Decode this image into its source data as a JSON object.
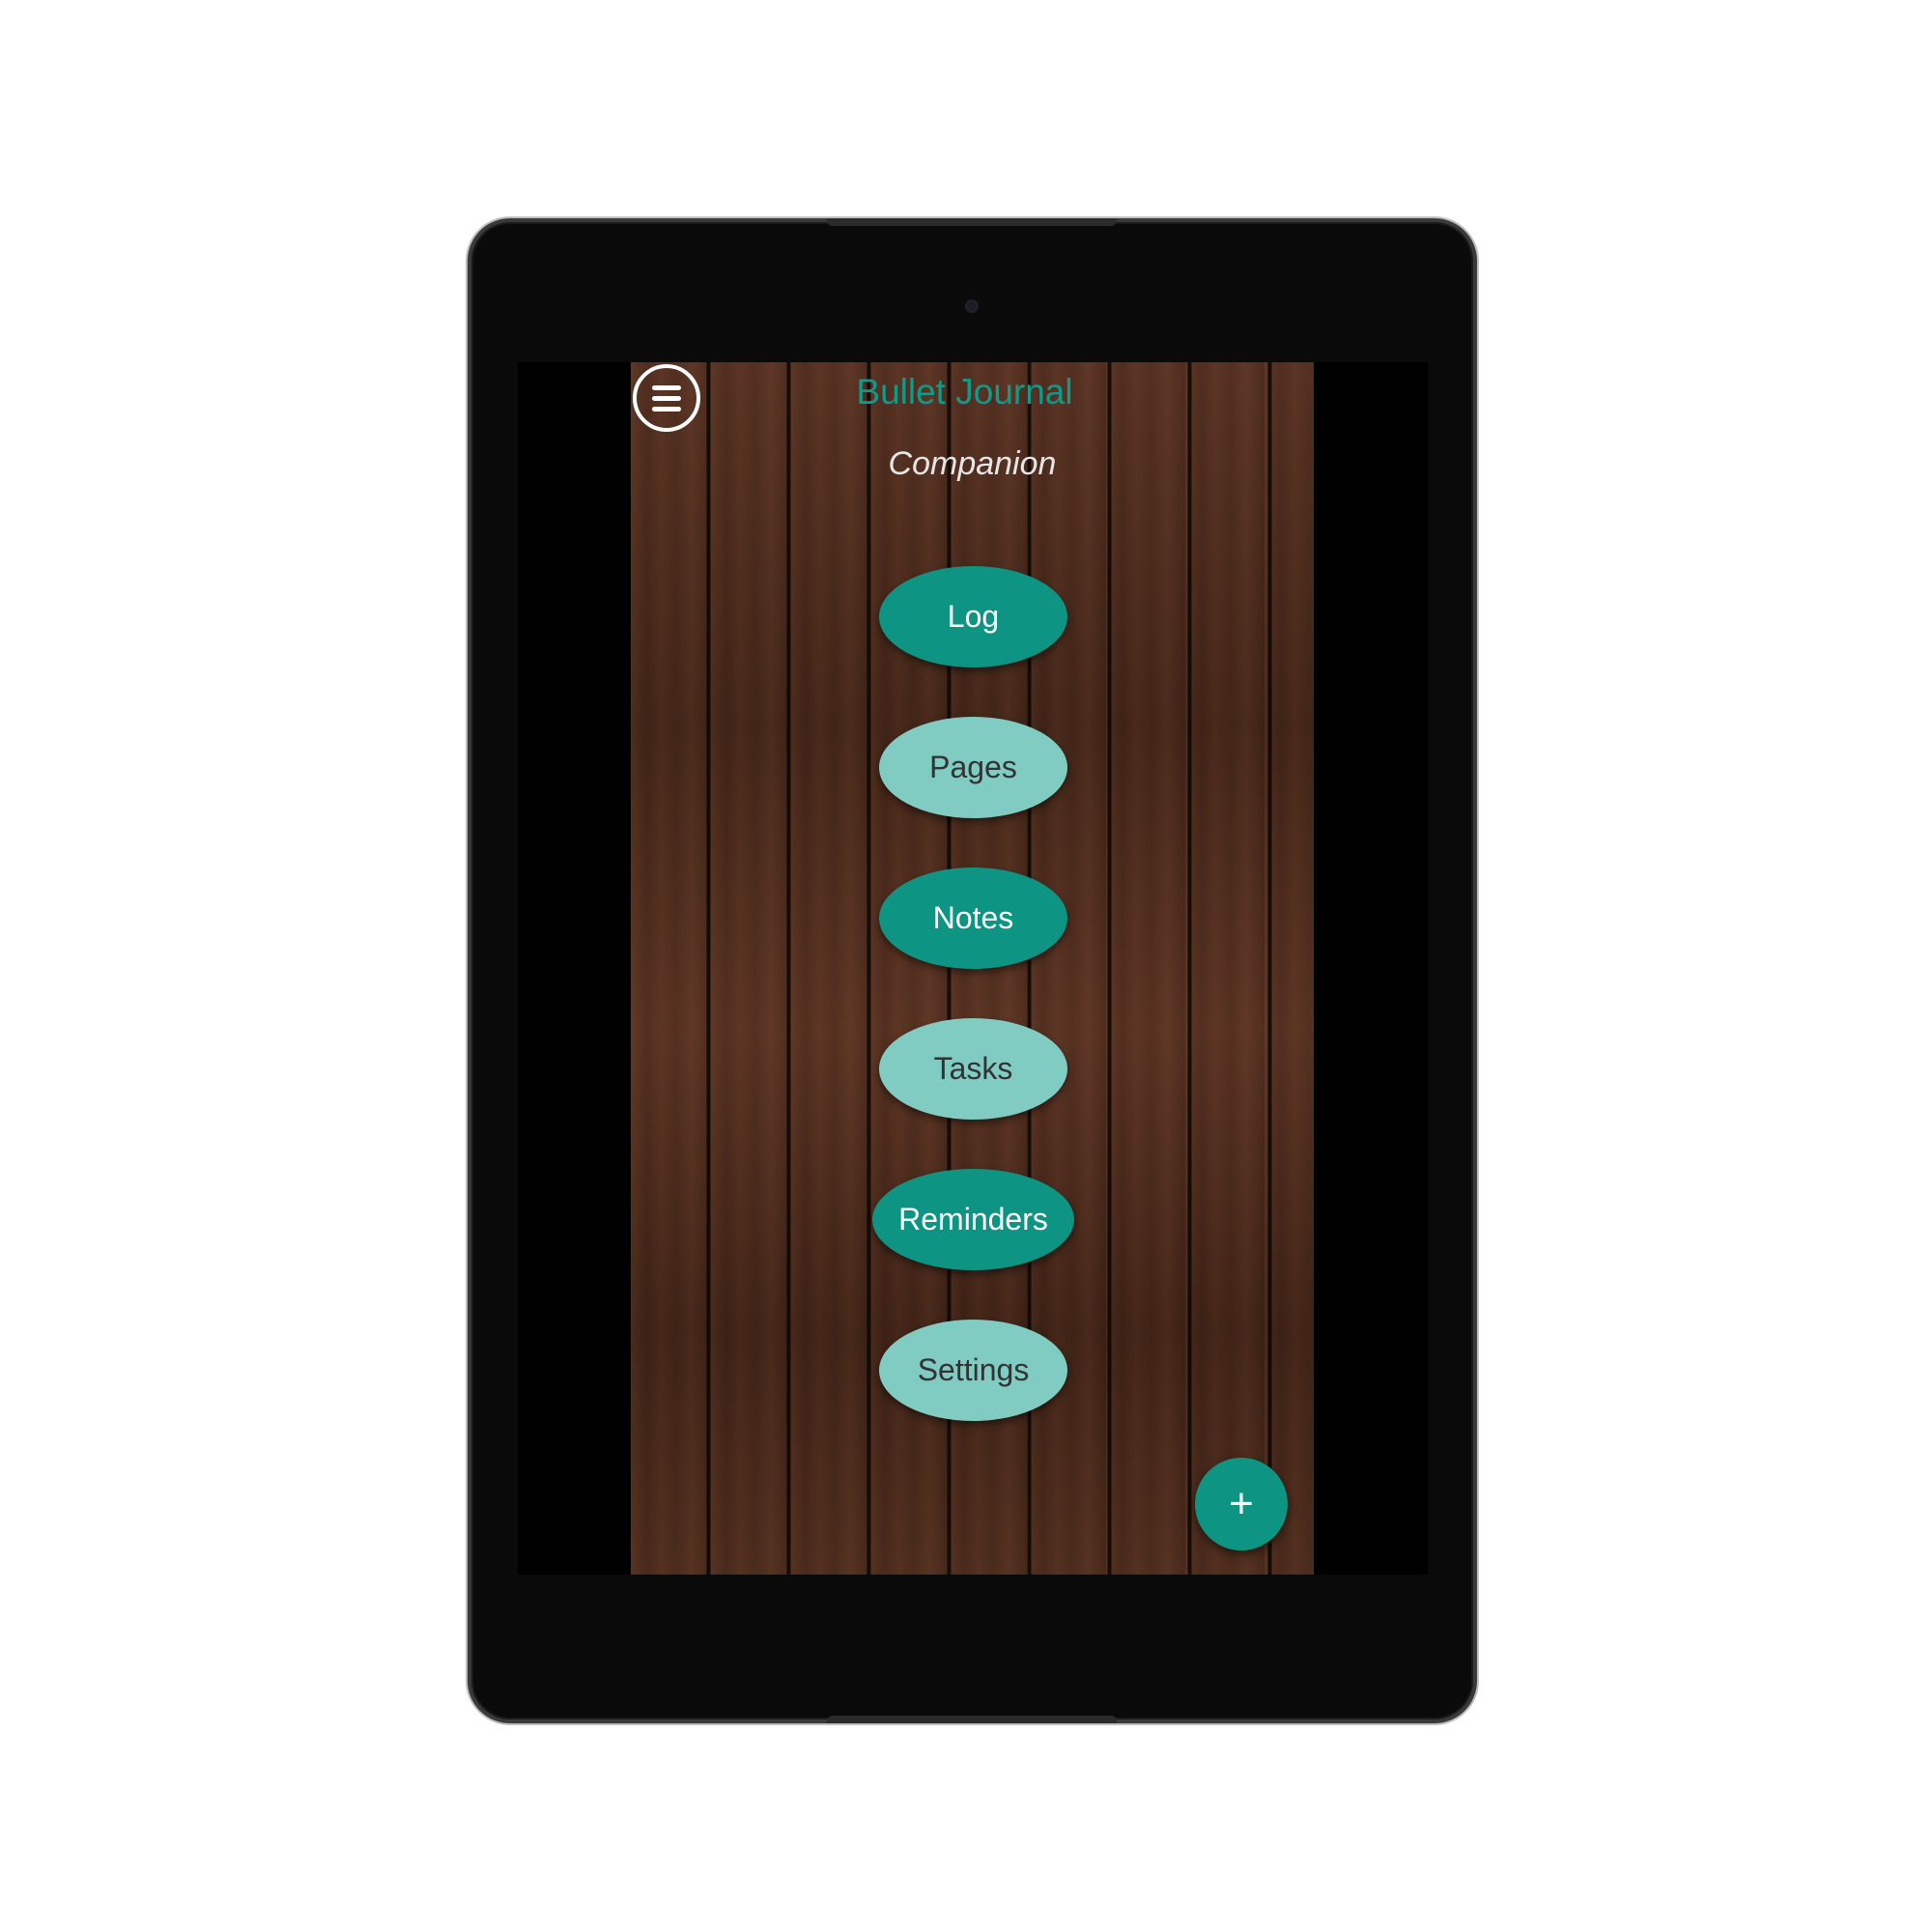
{
  "app": {
    "title": "Bullet Journal",
    "subtitle": "Companion"
  },
  "menu": {
    "icon": "menu-icon"
  },
  "nav": {
    "items": [
      {
        "label": "Log",
        "style": "dark"
      },
      {
        "label": "Pages",
        "style": "light"
      },
      {
        "label": "Notes",
        "style": "dark"
      },
      {
        "label": "Tasks",
        "style": "light"
      },
      {
        "label": "Reminders",
        "style": "dark"
      },
      {
        "label": "Settings",
        "style": "light"
      }
    ]
  },
  "fab": {
    "icon": "plus-icon",
    "symbol": "+"
  },
  "colors": {
    "accent_dark": "#0e9483",
    "accent_light": "#80cbc2",
    "title": "#0f9a8a"
  }
}
